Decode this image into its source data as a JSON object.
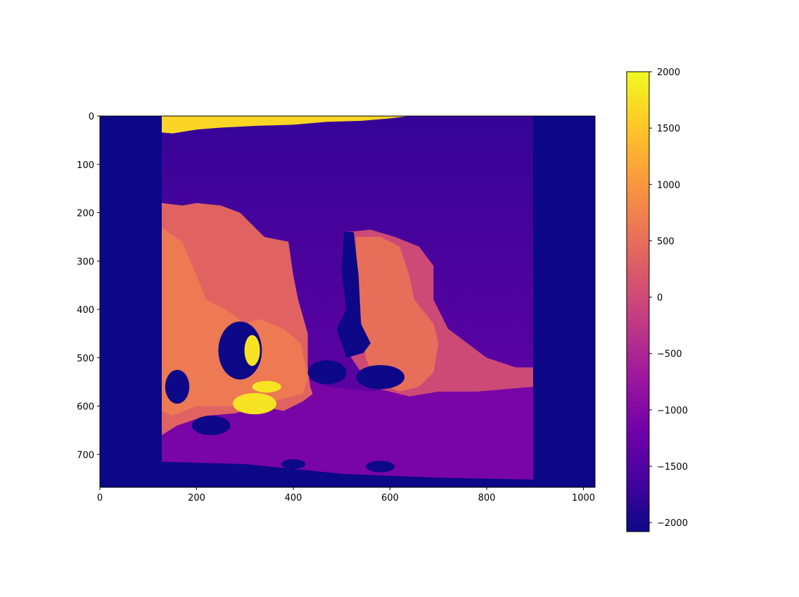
{
  "chart_data": {
    "type": "heatmap",
    "title": "",
    "xlabel": "",
    "ylabel": "",
    "image_size": {
      "cols": 1024,
      "rows": 768
    },
    "xlim": [
      0,
      1024
    ],
    "ylim": [
      768,
      0
    ],
    "x_ticks": [
      0,
      200,
      400,
      600,
      800,
      1000
    ],
    "y_ticks": [
      0,
      100,
      200,
      300,
      400,
      500,
      600,
      700
    ],
    "colormap": "plasma",
    "colormap_stops": [
      "#0d0887",
      "#46039f",
      "#7201a8",
      "#9c179e",
      "#bd3786",
      "#d8576b",
      "#ed7953",
      "#fb9f3a",
      "#fdca26",
      "#f0f921"
    ],
    "colorbar": {
      "range": [
        -2080,
        2000
      ],
      "ticks": [
        2000,
        1500,
        1000,
        500,
        0,
        -500,
        -1000,
        -1500,
        -2000
      ],
      "tick_labels": [
        "2000",
        "1500",
        "1000",
        "500",
        "0",
        "−500",
        "−1000",
        "−1500",
        "−2000"
      ]
    },
    "regions": [
      {
        "name": "left-border-band",
        "value": -2080
      },
      {
        "name": "right-border-band",
        "value": -2080
      },
      {
        "name": "sky-top",
        "value": -1750
      },
      {
        "name": "sky-lower",
        "value": -1250
      },
      {
        "name": "top-bright-strip",
        "value": 1650
      },
      {
        "name": "foreground-ground",
        "value": -1100
      },
      {
        "name": "left-rock-outer",
        "value": 350
      },
      {
        "name": "left-rock-face",
        "value": 650
      },
      {
        "name": "left-rock-bright-patches",
        "value": 1800
      },
      {
        "name": "right-rock-outer",
        "value": 0
      },
      {
        "name": "right-rock-face",
        "value": 500
      },
      {
        "name": "invalid-holes",
        "value": -2080
      }
    ]
  }
}
